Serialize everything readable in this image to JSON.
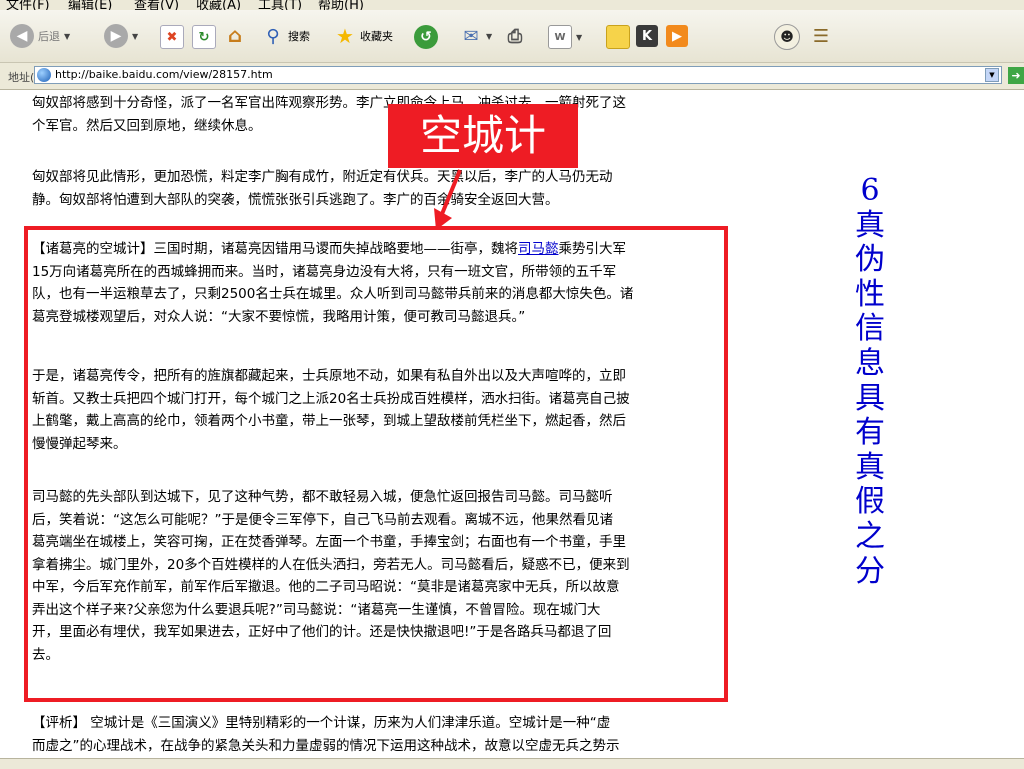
{
  "menubar": [
    "文件(F)",
    "编辑(E)",
    "查看(V)",
    "收藏(A)",
    "工具(T)",
    "帮助(H)"
  ],
  "toolbar": {
    "back": "后退",
    "search": "搜索",
    "favorites": "收藏夹"
  },
  "address": {
    "label": "地址(D)",
    "url": "http://baike.baidu.com/view/28157.htm"
  },
  "banner": "空城计",
  "sidebar": [
    "6",
    "真",
    "伪",
    "性",
    "信",
    "息",
    "具",
    "有",
    "真",
    "假",
    "之",
    "分"
  ],
  "article": {
    "p1": [
      "匈奴部将感到十分奇怪，派了一名军官出阵观察形势。李广立即命令上马，冲杀过去，一箭射死了这",
      "个军官。然后又回到原地，继续休息。"
    ],
    "p2": [
      "匈奴部将见此情形，更加恐慌，料定李广胸有成竹，附近定有伏兵。天黑以后，李广的人马仍无动",
      "静。匈奴部将怕遭到大部队的突袭，慌慌张张引兵逃跑了。李广的百余骑安全返回大营。"
    ],
    "p3": {
      "line1_pre": "【诸葛亮的空城计】三国时期，诸葛亮因错用马谡而失掉战略要地——街亭，魏将",
      "line1_link": "司马懿",
      "line1_post": "乘势引大军",
      "rest": [
        "15万向诸葛亮所在的西城蜂拥而来。当时，诸葛亮身边没有大将，只有一班文官，所带领的五千军",
        "队，也有一半运粮草去了，只剩2500名士兵在城里。众人听到司马懿带兵前来的消息都大惊失色。诸",
        "葛亮登城楼观望后，对众人说：“大家不要惊慌，我略用计策，便可教司马懿退兵。”"
      ]
    },
    "p4": [
      "于是，诸葛亮传令，把所有的旌旗都藏起来，士兵原地不动，如果有私自外出以及大声喧哗的，立即",
      "斩首。又教士兵把四个城门打开，每个城门之上派20名士兵扮成百姓模样，洒水扫街。诸葛亮自己披",
      "上鹤氅，戴上高高的纶巾，领着两个小书童，带上一张琴，到城上望敌楼前凭栏坐下，燃起香，然后",
      "慢慢弹起琴来。"
    ],
    "p5": [
      "司马懿的先头部队到达城下，见了这种气势，都不敢轻易入城，便急忙返回报告司马懿。司马懿听",
      "后，笑着说：“这怎么可能呢？”于是便令三军停下，自己飞马前去观看。离城不远，他果然看见诸",
      "葛亮端坐在城楼上，笑容可掬，正在焚香弹琴。左面一个书童，手捧宝剑；右面也有一个书童，手里",
      "拿着拂尘。城门里外，20多个百姓模样的人在低头洒扫，旁若无人。司马懿看后，疑惑不已，便来到",
      "中军，今后军充作前军，前军作后军撤退。他的二子司马昭说：“莫非是诸葛亮家中无兵，所以故意",
      "弄出这个样子来?父亲您为什么要退兵呢?”司马懿说：“诸葛亮一生谨慎，不曾冒险。现在城门大",
      "开，里面必有埋伏，我军如果进去，正好中了他们的计。还是快快撤退吧!”于是各路兵马都退了回",
      "去。"
    ],
    "p6": [
      "【评析】 空城计是《三国演义》里特别精彩的一个计谋，历来为人们津津乐道。空城计是一种“虚",
      "而虚之”的心理战术，在战争的紧急关头和力量虚弱的情况下运用这种战术，故意以空虚无兵之势示"
    ]
  },
  "colors": {
    "highlight_red": "#ee1c24",
    "sidebar_blue": "#0000cc"
  }
}
